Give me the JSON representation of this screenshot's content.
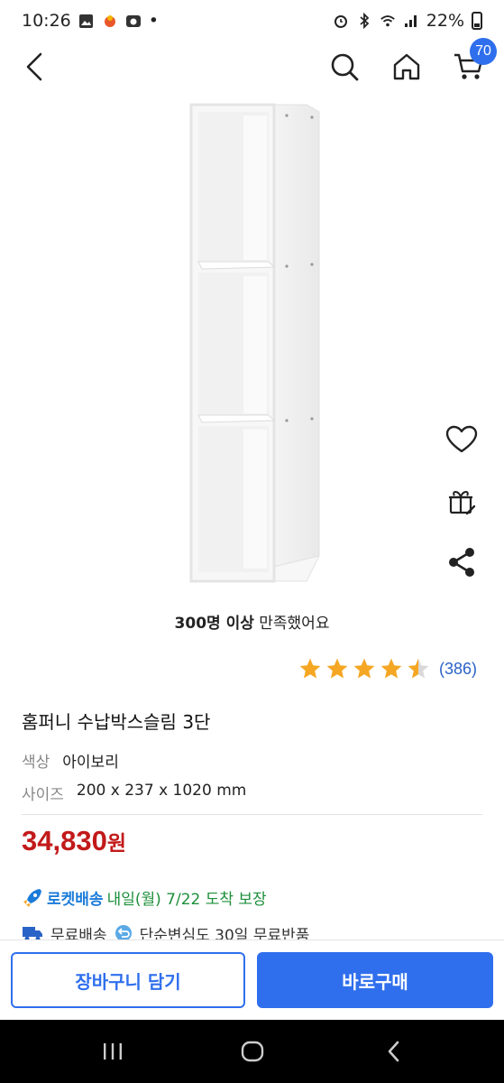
{
  "status_bar": {
    "time": "10:26",
    "dot": "•",
    "battery": "22%"
  },
  "header": {
    "cart_count": "70"
  },
  "product": {
    "satisfaction_bold": "300명 이상",
    "satisfaction_rest": " 만족했어요",
    "rating": 4.5,
    "review_count": "(386)",
    "title": "홈퍼니 수납박스슬림 3단",
    "color_label": "색상",
    "color_value": "아이보리",
    "size_label": "사이즈",
    "size_value": "200 x 237 x 1020 mm",
    "price": "34,830",
    "price_unit": "원"
  },
  "delivery": {
    "rocket_label": "로켓배송",
    "text": "내일(월) 7/22 도착 보장"
  },
  "benefits": {
    "free_shipping": "무료배송",
    "return_text": "단순변심도 30일 무료반품"
  },
  "actions": {
    "add_to_cart": "장바구니 담기",
    "buy_now": "바로구매"
  },
  "colors": {
    "accent": "#2f6fed",
    "price": "#c21a1a",
    "delivery_green": "#1c8f3a",
    "rocket_blue": "#1a7bd9",
    "star": "#f5a623"
  },
  "icons": [
    "back-icon",
    "search-icon",
    "home-icon",
    "cart-icon",
    "heart-icon",
    "gift-icon",
    "share-icon",
    "rocket-icon",
    "truck-icon",
    "return-icon"
  ]
}
